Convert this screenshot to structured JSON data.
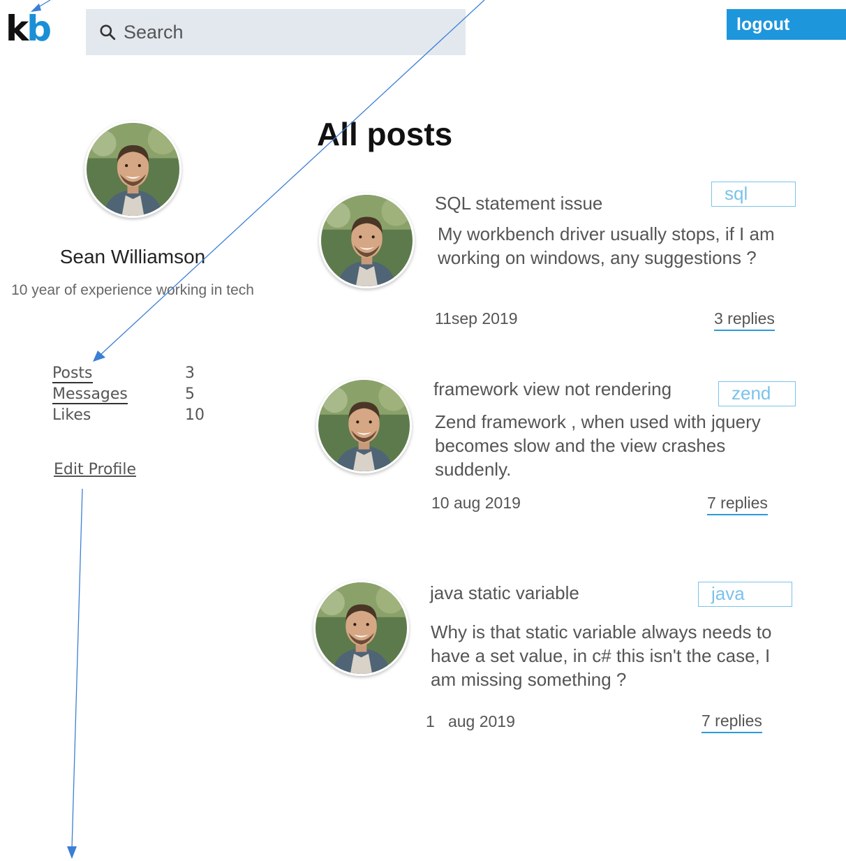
{
  "header": {
    "logo_k": "k",
    "logo_b": "b",
    "search_placeholder": "Search",
    "logout_label": "logout"
  },
  "profile": {
    "name": "Sean Williamson",
    "bio": "10 year of experience working in tech",
    "stats": [
      {
        "label": "Posts",
        "value": "3"
      },
      {
        "label": "Messages",
        "value": "5"
      },
      {
        "label": "Likes",
        "value": "10"
      }
    ],
    "edit_label": "Edit Profile"
  },
  "feed": {
    "title": "All posts",
    "posts": [
      {
        "title": "SQL statement issue",
        "tag": "sql",
        "body": "My workbench driver usually stops, if I am working on windows, any suggestions ?",
        "date": "11sep 2019",
        "replies": "3 replies"
      },
      {
        "title": "framework view not rendering",
        "tag": "zend",
        "body": "Zend framework , when used with jquery becomes slow and the view crashes suddenly.",
        "date": "10 aug 2019",
        "replies": "7 replies"
      },
      {
        "title": "java static variable",
        "tag": "java",
        "body": "Why is that static variable always needs to have a set value, in c# this isn't the case, I am missing something ?",
        "date": "1   aug 2019",
        "replies": "7 replies"
      }
    ]
  },
  "colors": {
    "accent": "#1e96dc",
    "tag_border": "#7bc2ea",
    "search_bg": "#e2e8ee"
  }
}
